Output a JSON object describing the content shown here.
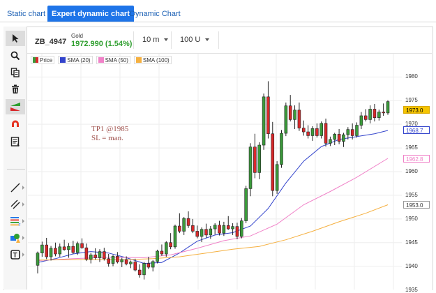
{
  "tabs": [
    {
      "label": "Static chart",
      "active": false
    },
    {
      "label": "Expert dynamic chart",
      "active": true
    },
    {
      "label": "Dynamic Chart",
      "active": false
    }
  ],
  "header": {
    "symbol": "ZB_4947",
    "instrument": "Gold",
    "price": "1972.990 (1.54%)",
    "timeframe": "10 m",
    "units": "100 U"
  },
  "toolbar": {
    "icons": [
      "cursor-icon",
      "zoom-icon",
      "copy-icon",
      "trash-icon",
      "trend-indicator-icon",
      "magnet-icon",
      "report-icon",
      "line-tool-icon",
      "parallel-lines-icon",
      "fibonacci-icon",
      "shapes-icon",
      "text-tool-icon"
    ]
  },
  "legend": [
    {
      "label": "Price",
      "color": "#3a9a3a"
    },
    {
      "label": "SMA (20)",
      "color": "#3344cc"
    },
    {
      "label": "SMA (50)",
      "color": "#f082c8"
    },
    {
      "label": "SMA (100)",
      "color": "#f5b040"
    }
  ],
  "annotation": {
    "line1": "TP1 @1985",
    "line2": "SL = man."
  },
  "price_axis": {
    "ticks": [
      "1980",
      "1975",
      "1970",
      "1965",
      "1960",
      "1955",
      "1950",
      "1945",
      "1940",
      "1935"
    ],
    "tags": [
      {
        "label": "1973.0",
        "value": 1973.0,
        "bg": "#f5c400",
        "color": "#000000",
        "border": "#d9a800"
      },
      {
        "label": "1968.7",
        "value": 1968.7,
        "bg": "#ffffff",
        "color": "#3344cc",
        "border": "#3344cc"
      },
      {
        "label": "1962.8",
        "value": 1962.8,
        "bg": "#ffffff",
        "color": "#f082c8",
        "border": "#f082c8"
      },
      {
        "label": "1953.0",
        "value": 1953.0,
        "bg": "#ffffff",
        "color": "#333333",
        "border": "#999999"
      }
    ]
  },
  "chart_data": {
    "type": "candlestick",
    "ylim": [
      1937,
      1983
    ],
    "candles": [
      [
        1940.2,
        1943.1,
        1938.5,
        1942.8
      ],
      [
        1942.8,
        1945.2,
        1942.0,
        1944.5
      ],
      [
        1944.5,
        1946.0,
        1941.5,
        1942.0
      ],
      [
        1942.0,
        1944.3,
        1941.2,
        1943.8
      ],
      [
        1943.8,
        1945.0,
        1942.1,
        1942.6
      ],
      [
        1942.6,
        1944.8,
        1942.0,
        1944.1
      ],
      [
        1944.1,
        1945.6,
        1943.3,
        1943.5
      ],
      [
        1943.5,
        1944.9,
        1941.8,
        1944.2
      ],
      [
        1944.2,
        1945.4,
        1942.6,
        1942.9
      ],
      [
        1942.9,
        1945.2,
        1942.4,
        1944.8
      ],
      [
        1944.8,
        1945.9,
        1943.7,
        1943.9
      ],
      [
        1943.9,
        1944.8,
        1941.1,
        1941.5
      ],
      [
        1941.5,
        1942.8,
        1940.6,
        1942.4
      ],
      [
        1942.4,
        1943.8,
        1941.4,
        1941.8
      ],
      [
        1941.8,
        1943.6,
        1940.9,
        1943.1
      ],
      [
        1943.1,
        1943.9,
        1941.2,
        1941.6
      ],
      [
        1941.6,
        1942.6,
        1939.9,
        1940.6
      ],
      [
        1940.6,
        1942.4,
        1940.0,
        1942.1
      ],
      [
        1942.1,
        1943.0,
        1940.6,
        1940.9
      ],
      [
        1940.9,
        1941.8,
        1939.8,
        1941.4
      ],
      [
        1941.4,
        1942.1,
        1940.2,
        1940.5
      ],
      [
        1940.5,
        1941.2,
        1939.6,
        1940.9
      ],
      [
        1940.9,
        1941.6,
        1938.9,
        1939.2
      ],
      [
        1939.2,
        1940.4,
        1937.6,
        1938.2
      ],
      [
        1938.2,
        1940.9,
        1937.2,
        1940.6
      ],
      [
        1940.6,
        1942.0,
        1939.4,
        1939.8
      ],
      [
        1939.8,
        1941.3,
        1938.9,
        1941.0
      ],
      [
        1941.0,
        1943.5,
        1940.6,
        1943.2
      ],
      [
        1943.2,
        1944.6,
        1942.2,
        1942.6
      ],
      [
        1942.6,
        1945.3,
        1942.0,
        1945.0
      ],
      [
        1945.0,
        1947.0,
        1943.6,
        1944.1
      ],
      [
        1944.1,
        1948.8,
        1943.7,
        1948.5
      ],
      [
        1948.5,
        1951.2,
        1947.0,
        1947.4
      ],
      [
        1947.4,
        1950.4,
        1946.6,
        1950.1
      ],
      [
        1950.1,
        1951.6,
        1948.1,
        1948.6
      ],
      [
        1948.6,
        1950.0,
        1947.0,
        1947.4
      ],
      [
        1947.4,
        1948.6,
        1945.9,
        1946.3
      ],
      [
        1946.3,
        1948.2,
        1945.1,
        1947.8
      ],
      [
        1947.8,
        1949.0,
        1946.0,
        1946.6
      ],
      [
        1946.6,
        1948.5,
        1945.8,
        1947.9
      ],
      [
        1947.9,
        1949.1,
        1946.7,
        1948.7
      ],
      [
        1948.7,
        1949.6,
        1946.5,
        1947.0
      ],
      [
        1947.0,
        1949.4,
        1946.4,
        1948.6
      ],
      [
        1948.6,
        1950.6,
        1947.7,
        1947.9
      ],
      [
        1947.9,
        1949.1,
        1946.6,
        1948.4
      ],
      [
        1948.4,
        1949.2,
        1945.7,
        1946.3
      ],
      [
        1946.3,
        1950.2,
        1945.9,
        1949.6
      ],
      [
        1949.6,
        1957.0,
        1949.1,
        1956.4
      ],
      [
        1956.4,
        1966.0,
        1954.8,
        1965.2
      ],
      [
        1965.2,
        1968.0,
        1958.6,
        1959.8
      ],
      [
        1959.8,
        1966.2,
        1958.4,
        1965.6
      ],
      [
        1965.6,
        1976.5,
        1964.6,
        1975.8
      ],
      [
        1975.8,
        1979.1,
        1967.0,
        1968.0
      ],
      [
        1968.0,
        1970.5,
        1954.8,
        1956.0
      ],
      [
        1956.0,
        1962.2,
        1955.3,
        1961.5
      ],
      [
        1961.5,
        1968.8,
        1960.8,
        1968.1
      ],
      [
        1968.1,
        1974.6,
        1967.5,
        1973.9
      ],
      [
        1973.9,
        1976.2,
        1970.6,
        1971.0
      ],
      [
        1971.0,
        1974.0,
        1969.0,
        1973.0
      ],
      [
        1973.0,
        1974.6,
        1968.6,
        1969.2
      ],
      [
        1969.2,
        1970.8,
        1967.6,
        1968.4
      ],
      [
        1968.4,
        1969.8,
        1967.0,
        1967.6
      ],
      [
        1967.6,
        1969.6,
        1966.5,
        1969.1
      ],
      [
        1969.1,
        1970.2,
        1967.2,
        1967.6
      ],
      [
        1967.6,
        1970.6,
        1967.0,
        1970.2
      ],
      [
        1970.2,
        1971.2,
        1965.3,
        1966.0
      ],
      [
        1966.0,
        1967.4,
        1965.4,
        1966.8
      ],
      [
        1966.8,
        1968.2,
        1965.6,
        1967.9
      ],
      [
        1967.9,
        1969.0,
        1965.8,
        1966.4
      ],
      [
        1966.4,
        1968.2,
        1965.2,
        1967.8
      ],
      [
        1967.8,
        1969.4,
        1966.8,
        1968.9
      ],
      [
        1968.9,
        1970.2,
        1966.8,
        1967.6
      ],
      [
        1967.6,
        1970.4,
        1967.2,
        1969.8
      ],
      [
        1969.8,
        1972.6,
        1969.0,
        1971.8
      ],
      [
        1971.8,
        1973.2,
        1970.6,
        1971.0
      ],
      [
        1971.0,
        1974.0,
        1970.2,
        1973.2
      ],
      [
        1973.2,
        1974.3,
        1970.6,
        1971.4
      ],
      [
        1971.4,
        1973.1,
        1970.8,
        1972.6
      ],
      [
        1972.6,
        1974.4,
        1971.8,
        1972.4
      ],
      [
        1972.4,
        1975.1,
        1972.0,
        1974.8
      ]
    ],
    "series": [
      {
        "name": "SMA (20)",
        "color": "#3344cc",
        "x": [
          0,
          4,
          8,
          12,
          16,
          20,
          24,
          28,
          32,
          36,
          40,
          44,
          48,
          52,
          56,
          60,
          64,
          68,
          72,
          76,
          79
        ],
        "values": [
          1940.8,
          1941.6,
          1942.6,
          1943.1,
          1942.8,
          1941.8,
          1940.6,
          1940.8,
          1942.8,
          1945.3,
          1946.6,
          1947.1,
          1948.5,
          1952.2,
          1957.6,
          1962.2,
          1965.3,
          1966.8,
          1967.4,
          1968.0,
          1968.7
        ]
      },
      {
        "name": "SMA (50)",
        "color": "#f082c8",
        "x": [
          0,
          8,
          16,
          24,
          30,
          36,
          42,
          48,
          54,
          60,
          66,
          72,
          79
        ],
        "values": [
          1941.2,
          1941.6,
          1941.9,
          1941.8,
          1942.4,
          1943.8,
          1945.4,
          1946.4,
          1948.9,
          1953.0,
          1955.8,
          1958.8,
          1962.8
        ]
      },
      {
        "name": "SMA (100)",
        "color": "#f5b040",
        "x": [
          0,
          10,
          20,
          26,
          32,
          38,
          44,
          50,
          56,
          62,
          68,
          74,
          79
        ],
        "values": [
          1941.3,
          1941.4,
          1941.4,
          1941.6,
          1942.0,
          1942.8,
          1943.6,
          1944.2,
          1945.6,
          1947.4,
          1949.4,
          1951.2,
          1953.0
        ]
      }
    ]
  }
}
